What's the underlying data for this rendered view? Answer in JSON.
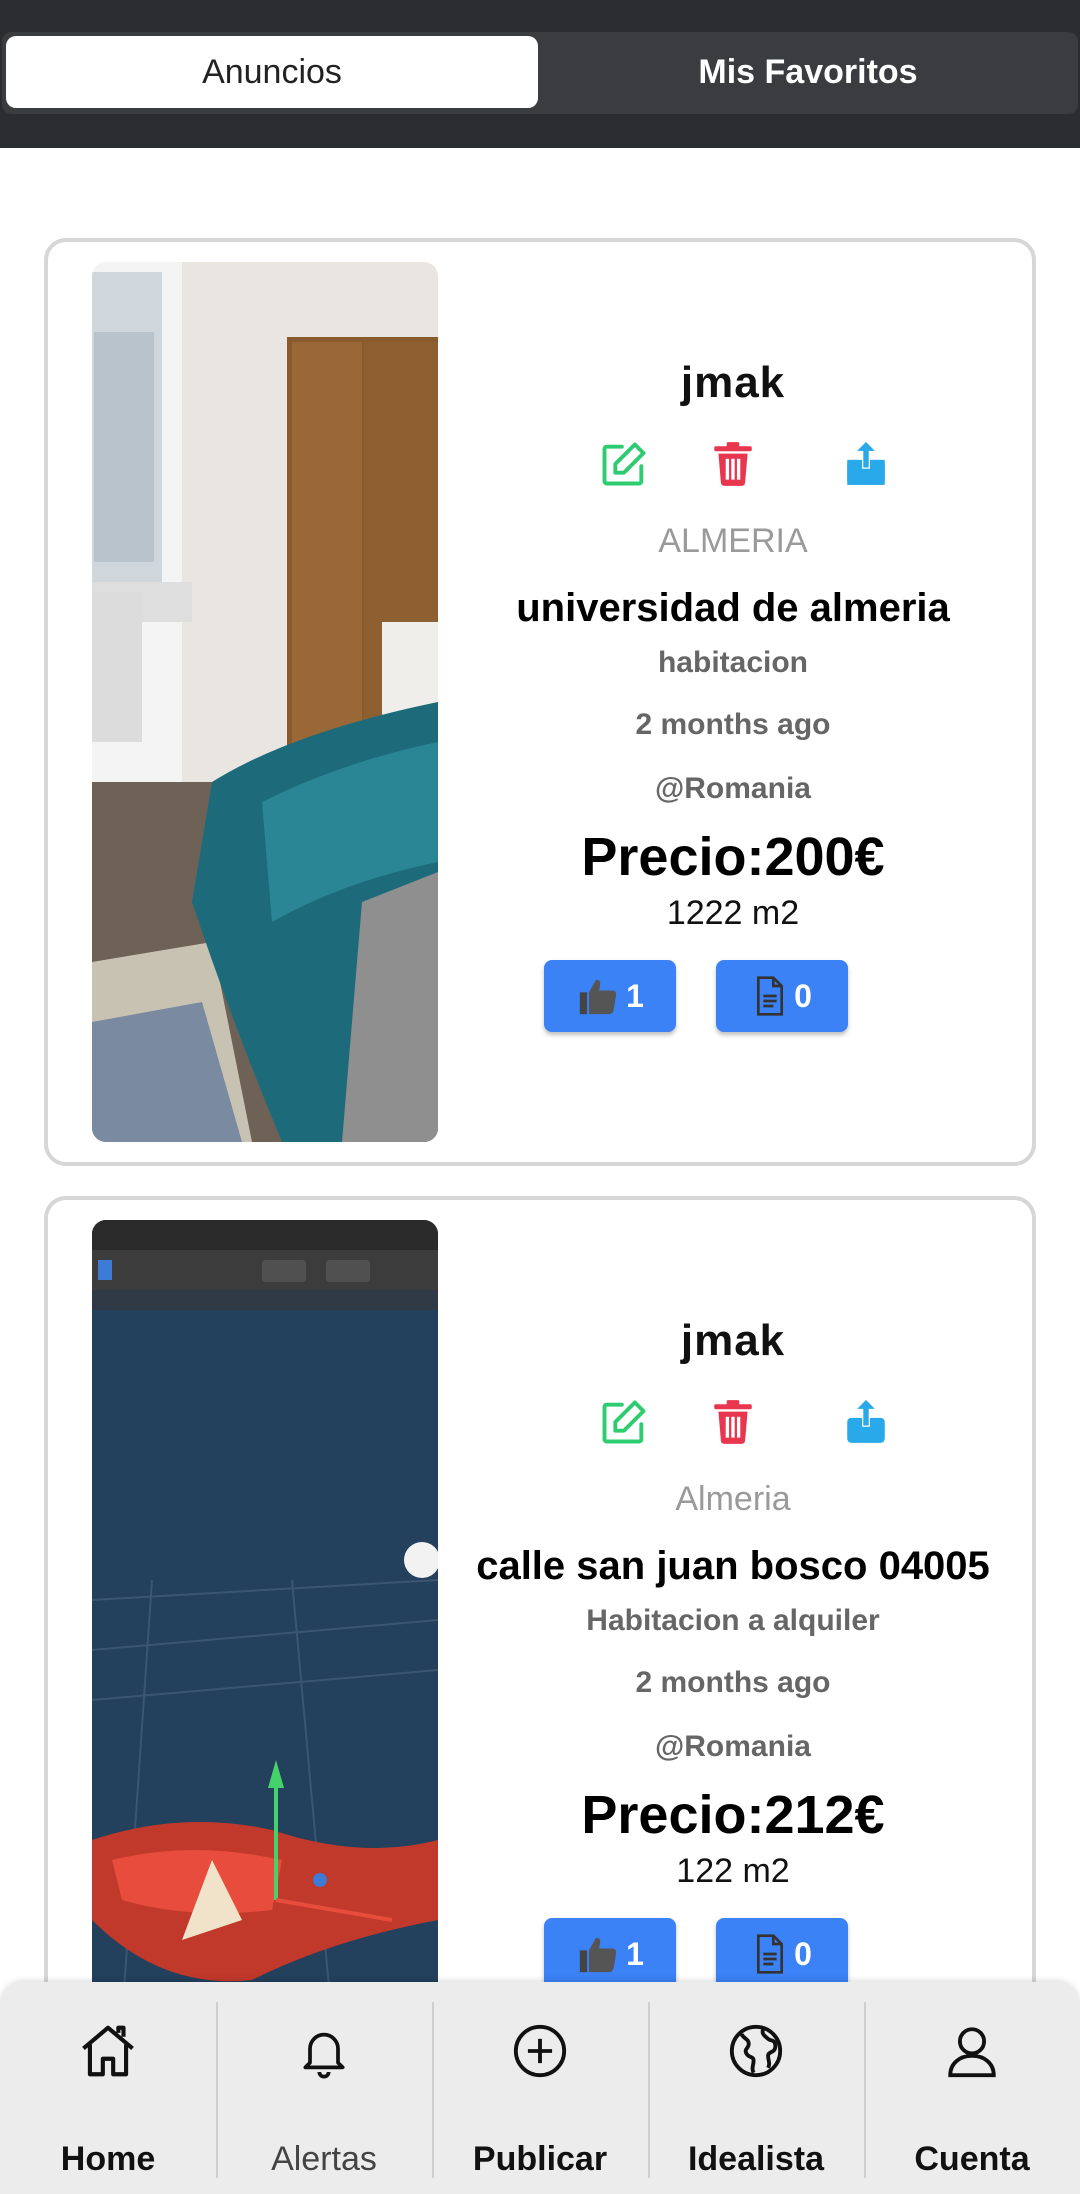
{
  "tabs": {
    "active": "Anuncios",
    "inactive": "Mis Favoritos"
  },
  "listings": [
    {
      "owner": "jmak",
      "city": "ALMERIA",
      "address": "universidad de almeria",
      "type": "habitacion",
      "posted": "2 months ago",
      "user": "@Romania",
      "price": "Precio:200€",
      "size": "1222 m2",
      "likes": "1",
      "documents": "0"
    },
    {
      "owner": "jmak",
      "city": "Almeria",
      "address": "calle san juan bosco 04005",
      "type": "Habitacion a alquiler",
      "posted": "2 months ago",
      "user": "@Romania",
      "price": "Precio:212€",
      "size": "122 m2",
      "likes": "1",
      "documents": "0"
    }
  ],
  "nav": [
    {
      "label": "Home",
      "icon": "home-icon"
    },
    {
      "label": "Alertas",
      "icon": "bell-icon"
    },
    {
      "label": "Publicar",
      "icon": "plus-circle-icon"
    },
    {
      "label": "Idealista",
      "icon": "globe-icon"
    },
    {
      "label": "Cuenta",
      "icon": "user-icon"
    }
  ],
  "colors": {
    "edit": "#2ecc71",
    "delete": "#e8364f",
    "share": "#29a8ea",
    "button": "#3b82f6",
    "topbar": "#2b2d31"
  }
}
